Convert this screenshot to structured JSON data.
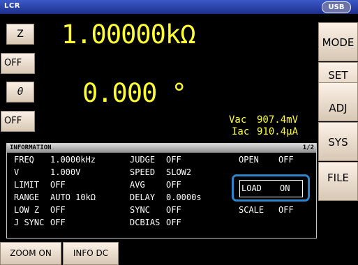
{
  "header": {
    "mode": "LCR",
    "usb": "USB"
  },
  "left_buttons": {
    "param1": "Z",
    "param1_range": "OFF",
    "param2": "θ",
    "param2_range": "OFF"
  },
  "main_display": {
    "value1": "1.00000kΩ",
    "value2": "0.000 °"
  },
  "monitor": {
    "vac_label": "Vac",
    "vac_value": "907.4mV",
    "iac_label": "Iac",
    "iac_value": "910.4μA"
  },
  "right_menu": [
    "MODE",
    "SET",
    "ADJ",
    "SYS",
    "FILE"
  ],
  "info": {
    "title": "INFORMATION",
    "page": "1/2",
    "col1": [
      {
        "label": "FREQ",
        "value": "1.0000kHz"
      },
      {
        "label": "V",
        "value": "1.000V"
      },
      {
        "label": "LIMIT",
        "value": "OFF"
      },
      {
        "label": "RANGE",
        "value": "AUTO  10kΩ"
      },
      {
        "label": "LOW Z",
        "value": "OFF"
      },
      {
        "label": "J SYNC",
        "value": "OFF"
      }
    ],
    "col2": [
      {
        "label": "JUDGE",
        "value": "OFF"
      },
      {
        "label": "SPEED",
        "value": "SLOW2"
      },
      {
        "label": "AVG",
        "value": "OFF"
      },
      {
        "label": "DELAY",
        "value": "0.0000s"
      },
      {
        "label": "SYNC",
        "value": "OFF"
      },
      {
        "label": "DCBIAS",
        "value": "OFF"
      }
    ],
    "col3": [
      {
        "label": "OPEN",
        "value": "OFF"
      },
      {
        "label": "LOAD",
        "value": "ON"
      },
      {
        "label": "SCALE",
        "value": "OFF"
      }
    ]
  },
  "bottom_buttons": {
    "zoom": "ZOOM ON",
    "info_dc": "INFO DC"
  }
}
